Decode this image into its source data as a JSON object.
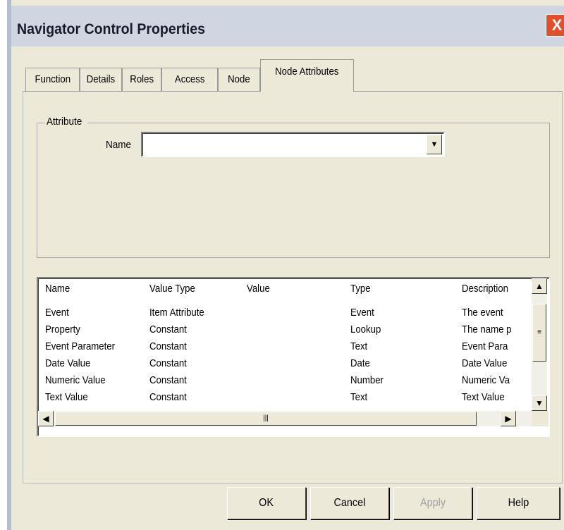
{
  "window": {
    "title": "Navigator Control Properties",
    "close_glyph": "X"
  },
  "tabs": [
    {
      "label": "Function"
    },
    {
      "label": "Details"
    },
    {
      "label": "Roles"
    },
    {
      "label": "Access"
    },
    {
      "label": "Node"
    },
    {
      "label": "Node Attributes",
      "selected": true
    }
  ],
  "attribute_group": {
    "legend": "Attribute",
    "name_label": "Name",
    "name_value": ""
  },
  "list": {
    "columns": [
      "Name",
      "Value Type",
      "Value",
      "Type",
      "Description"
    ],
    "rows": [
      [
        "Event",
        "Item Attribute",
        "",
        "Event",
        "The event"
      ],
      [
        "Property",
        "Constant",
        "",
        "Lookup",
        "The name p"
      ],
      [
        "Event Parameter",
        "Constant",
        "",
        "Text",
        "Event Para"
      ],
      [
        "Date Value",
        "Constant",
        "",
        "Date",
        "Date Value"
      ],
      [
        "Numeric Value",
        "Constant",
        "",
        "Number",
        "Numeric Va"
      ],
      [
        "Text Value",
        "Constant",
        "",
        "Text",
        "Text Value"
      ]
    ]
  },
  "buttons": {
    "ok": "OK",
    "cancel": "Cancel",
    "apply": "Apply",
    "help": "Help"
  },
  "colors": {
    "dialog_bg": "#ece9d8",
    "titlebar_bg": "#cfd6e2",
    "close_bg": "#e0502b"
  },
  "icons": {
    "combo": "triangle-down",
    "scroll_up": "chevron-up",
    "scroll_down": "chevron-down",
    "scroll_left": "chevron-left",
    "scroll_right": "chevron-right",
    "grip": "grip-lines"
  }
}
